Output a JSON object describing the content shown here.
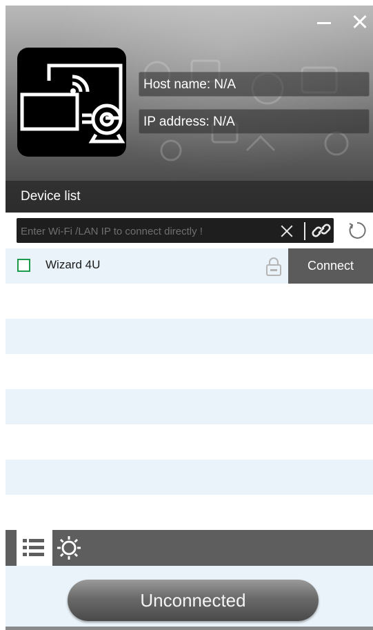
{
  "window": {
    "minimize_icon": "minimize-icon",
    "close_icon": "close-icon"
  },
  "header": {
    "logo_icon": "screen-cast-camera-icon",
    "host_name": "Host name: N/A",
    "ip_address": "IP address: N/A",
    "device_list_label": "Device list"
  },
  "search": {
    "placeholder": "Enter Wi-Fi /LAN IP to connect directly !",
    "value": "",
    "clear_icon": "close-icon",
    "link_icon": "link-icon",
    "refresh_icon": "refresh-icon"
  },
  "devices": [
    {
      "name": "Wizard 4U",
      "checked": false,
      "locked": true,
      "action_label": "Connect"
    }
  ],
  "tabs": [
    {
      "icon": "list-icon",
      "active": true
    },
    {
      "icon": "gear-icon",
      "active": false
    }
  ],
  "status": {
    "label": "Unconnected"
  },
  "colors": {
    "accent_green": "#1a9a4a",
    "stripe": "#e9f3f9",
    "connect_bg": "#5b5b5b",
    "tabbar_bg": "#5e5e5e"
  }
}
